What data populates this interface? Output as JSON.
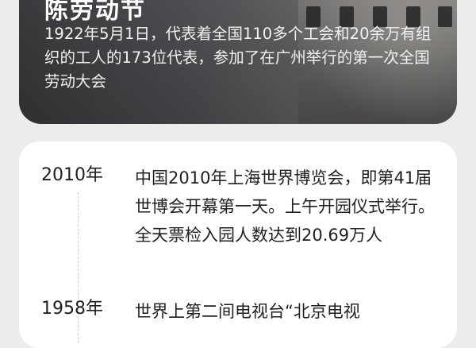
{
  "hero": {
    "title": "陈劳动节",
    "description": "1922年5月1日，代表着全国110多个工会和20余万有组织的工人的173位代表，参加了在广州举行的第一次全国劳动大会"
  },
  "timeline": {
    "entries": [
      {
        "year": "2010年",
        "text": "中国2010年上海世界博览会，即第41届世博会开幕第一天。上午开园仪式举行。全天票检入园人数达到20.69万人"
      },
      {
        "year": "1958年",
        "text": "世界上第二间电视台“北京电视"
      }
    ]
  }
}
